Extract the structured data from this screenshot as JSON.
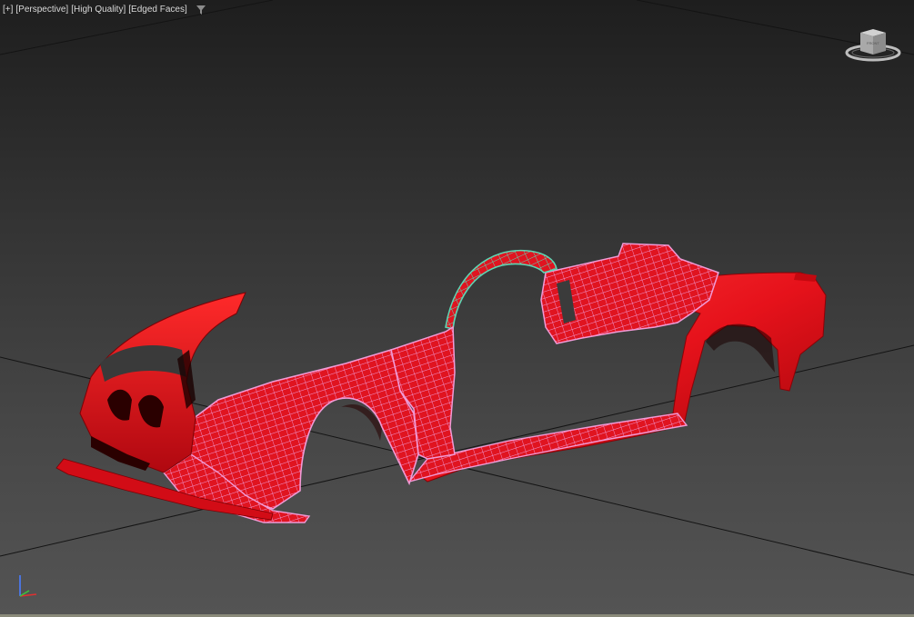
{
  "viewport": {
    "labels": [
      "[+]",
      "[Perspective]",
      "[High Quality]",
      "[Edged Faces]"
    ],
    "filter_icon": "funnel-icon",
    "viewcube_face": "FRONT",
    "axis_icons": [
      "x-axis-icon",
      "y-axis-icon",
      "z-axis-icon"
    ]
  },
  "colors": {
    "background_top": "#1e1e1e",
    "background_bottom": "#545454",
    "model_red": "#e8101a",
    "wire_pink": "#ee8fd0",
    "selection_green": "#5ed6b4",
    "grid_line": "#111111"
  }
}
